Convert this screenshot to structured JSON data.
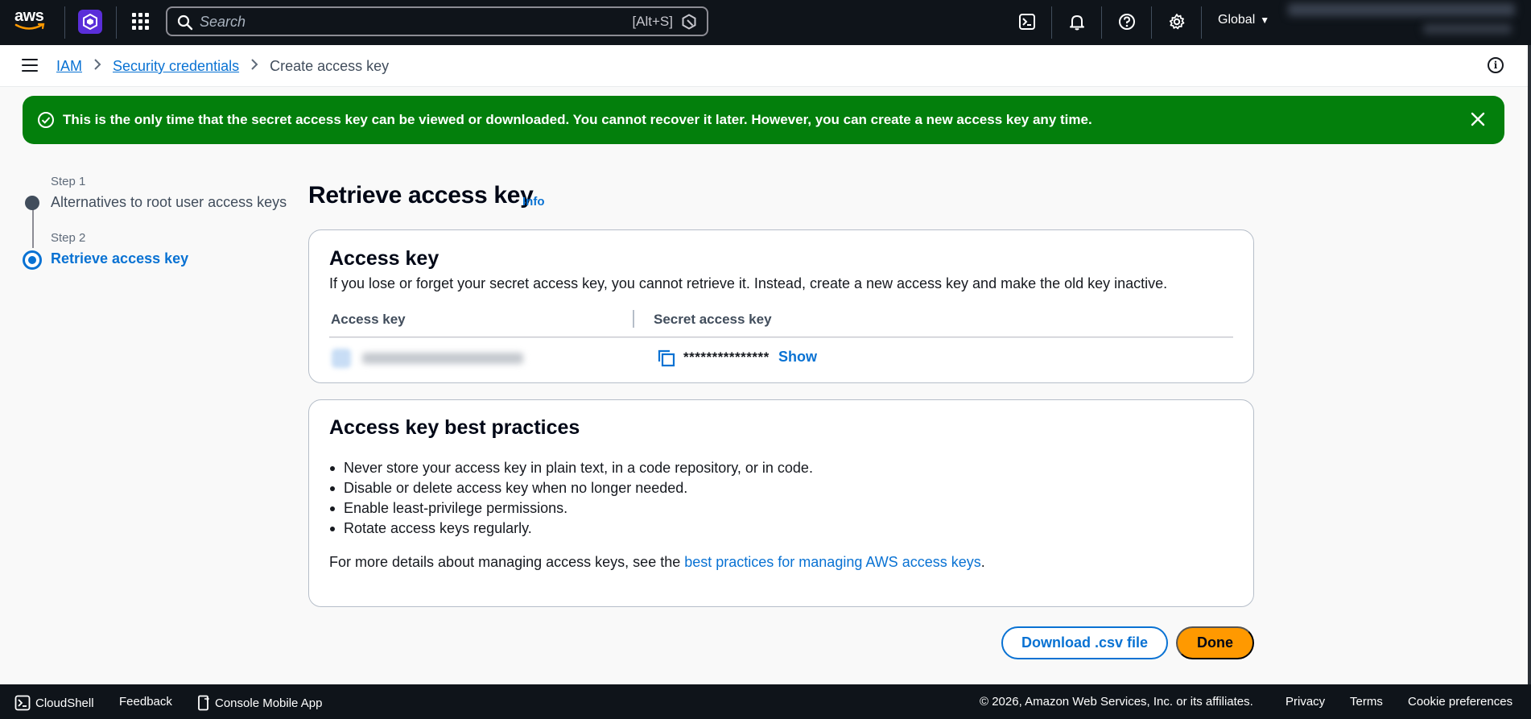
{
  "topnav": {
    "logo_text": "aws",
    "search_placeholder": "Search",
    "search_shortcut": "[Alt+S]",
    "region_label": "Global",
    "icons": [
      "cloudshell-icon",
      "bell-icon",
      "help-icon",
      "gear-icon"
    ]
  },
  "breadcrumb": {
    "items": [
      {
        "label": "IAM"
      },
      {
        "label": "Security credentials"
      }
    ],
    "current": "Create access key"
  },
  "flash": {
    "message": "This is the only time that the secret access key can be viewed or downloaded. You cannot recover it later. However, you can create a new access key any time."
  },
  "steps": [
    {
      "number": "Step 1",
      "label": "Alternatives to root user access keys"
    },
    {
      "number": "Step 2",
      "label": "Retrieve access key"
    }
  ],
  "page": {
    "title": "Retrieve access key",
    "info_link": "Info"
  },
  "access_key_card": {
    "heading": "Access key",
    "description": "If you lose or forget your secret access key, you cannot retrieve it. Instead, create a new access key and make the old key inactive.",
    "col_access_key": "Access key",
    "col_secret_key": "Secret access key",
    "secret_masked": "***************",
    "show_label": "Show"
  },
  "best_practices": {
    "heading": "Access key best practices",
    "items": [
      "Never store your access key in plain text, in a code repository, or in code.",
      "Disable or delete access key when no longer needed.",
      "Enable least-privilege permissions.",
      "Rotate access keys regularly."
    ],
    "more_prefix": "For more details about managing access keys, see the ",
    "more_link": "best practices for managing AWS access keys",
    "more_suffix": "."
  },
  "actions": {
    "download_label": "Download .csv file",
    "done_label": "Done"
  },
  "footer": {
    "cloudshell": "CloudShell",
    "feedback": "Feedback",
    "mobile_app": "Console Mobile App",
    "copyright": "© 2026, Amazon Web Services, Inc. or its affiliates.",
    "privacy": "Privacy",
    "terms": "Terms",
    "cookies": "Cookie preferences"
  },
  "colors": {
    "nav_bg": "#0f141a",
    "link": "#0972d3",
    "success": "#037f0c",
    "primary_button": "#ff9900"
  }
}
